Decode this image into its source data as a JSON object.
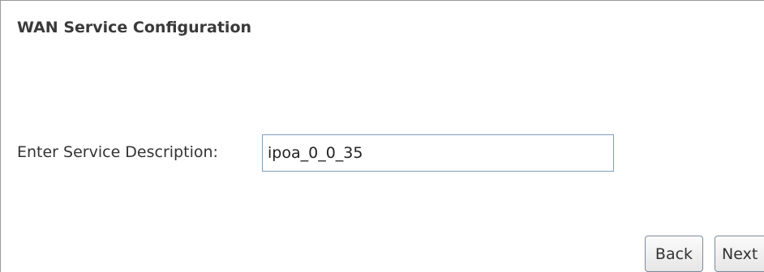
{
  "page": {
    "title": "WAN Service Configuration"
  },
  "service_description": {
    "label": "Enter Service Description:",
    "value": "ipoa_0_0_35"
  },
  "buttons": {
    "back_label": "Back",
    "next_label": "Next"
  }
}
